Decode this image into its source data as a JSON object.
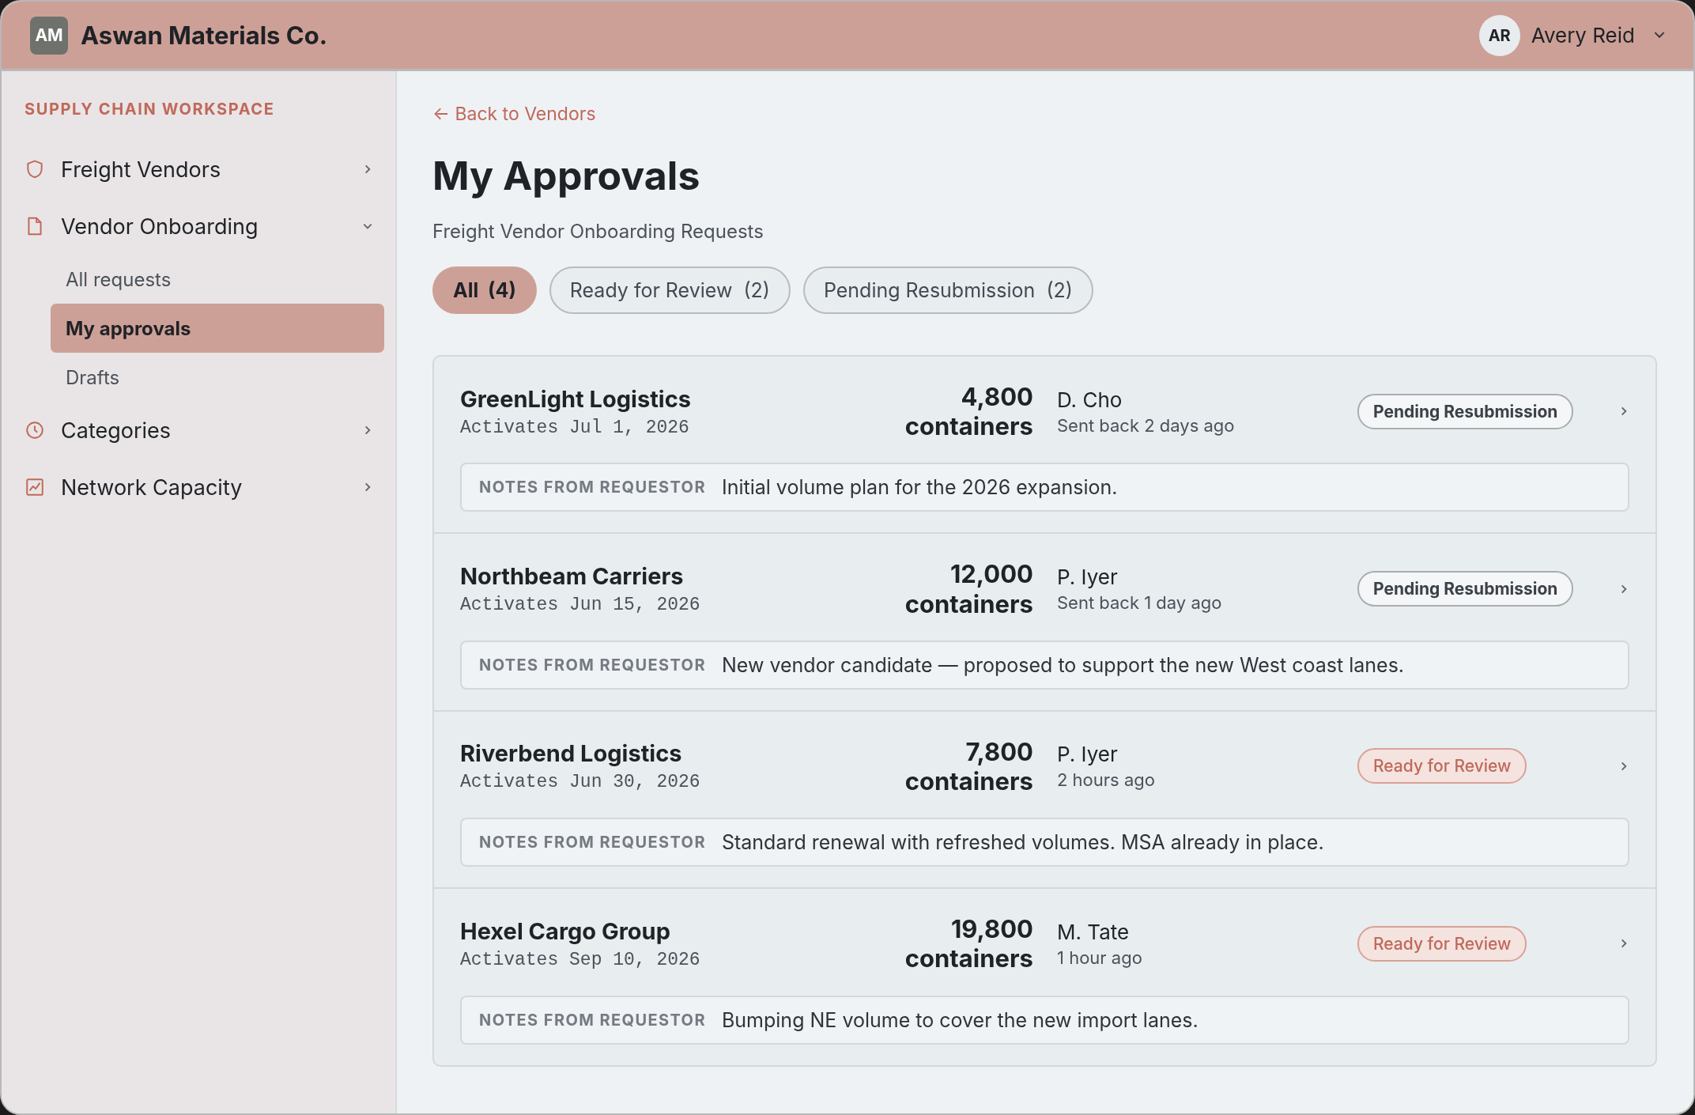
{
  "header": {
    "logo": "AM",
    "company": "Aswan Materials Co.",
    "user": {
      "initials": "AR",
      "name": "Avery Reid"
    }
  },
  "sidebar": {
    "section": "SUPPLY CHAIN WORKSPACE",
    "items": [
      {
        "label": "Freight Vendors",
        "kind": "shield",
        "expanded": false
      },
      {
        "label": "Vendor Onboarding",
        "kind": "document",
        "expanded": true,
        "children": [
          {
            "label": "All requests",
            "selected": false
          },
          {
            "label": "My approvals",
            "selected": true
          },
          {
            "label": "Drafts",
            "selected": false
          }
        ]
      },
      {
        "label": "Categories",
        "kind": "clock",
        "expanded": false
      },
      {
        "label": "Network Capacity",
        "kind": "chart",
        "expanded": false
      }
    ]
  },
  "back_link": "← Back to Vendors",
  "title": "My Approvals",
  "subtitle": "Freight Vendor Onboarding Requests",
  "filters": [
    {
      "label": "All",
      "count": "(4)",
      "selected": true
    },
    {
      "label": "Ready for Review",
      "count": "(2)",
      "selected": false
    },
    {
      "label": "Pending Resubmission",
      "count": "(2)",
      "selected": false
    }
  ],
  "requests": [
    {
      "vendor": "GreenLight Logistics",
      "activates": "Activates Jul 1, 2026",
      "volume": "4,800",
      "unit": "containers",
      "requestor": "D. Cho",
      "time": "Sent back 2 days ago",
      "status": {
        "kind": "pending",
        "label": "Pending Resubmission"
      },
      "notes_label": "NOTES FROM REQUESTOR",
      "notes": "Initial volume plan for the 2026 expansion."
    },
    {
      "vendor": "Northbeam Carriers",
      "activates": "Activates Jun 15, 2026",
      "volume": "12,000",
      "unit": "containers",
      "requestor": "P. Iyer",
      "time": "Sent back 1 day ago",
      "status": {
        "kind": "pending",
        "label": "Pending Resubmission"
      },
      "notes_label": "NOTES FROM REQUESTOR",
      "notes": "New vendor candidate — proposed to support the new West coast lanes."
    },
    {
      "vendor": "Riverbend Logistics",
      "activates": "Activates Jun 30, 2026",
      "volume": "7,800",
      "unit": "containers",
      "requestor": "P. Iyer",
      "time": "2 hours ago",
      "status": {
        "kind": "ready",
        "label": "Ready for Review"
      },
      "notes_label": "NOTES FROM REQUESTOR",
      "notes": "Standard renewal with refreshed volumes. MSA already in place."
    },
    {
      "vendor": "Hexel Cargo Group",
      "activates": "Activates Sep 10, 2026",
      "volume": "19,800",
      "unit": "containers",
      "requestor": "M. Tate",
      "time": "1 hour ago",
      "status": {
        "kind": "ready",
        "label": "Ready for Review"
      },
      "notes_label": "NOTES FROM REQUESTOR",
      "notes": "Bumping NE volume to cover the new import lanes."
    }
  ]
}
